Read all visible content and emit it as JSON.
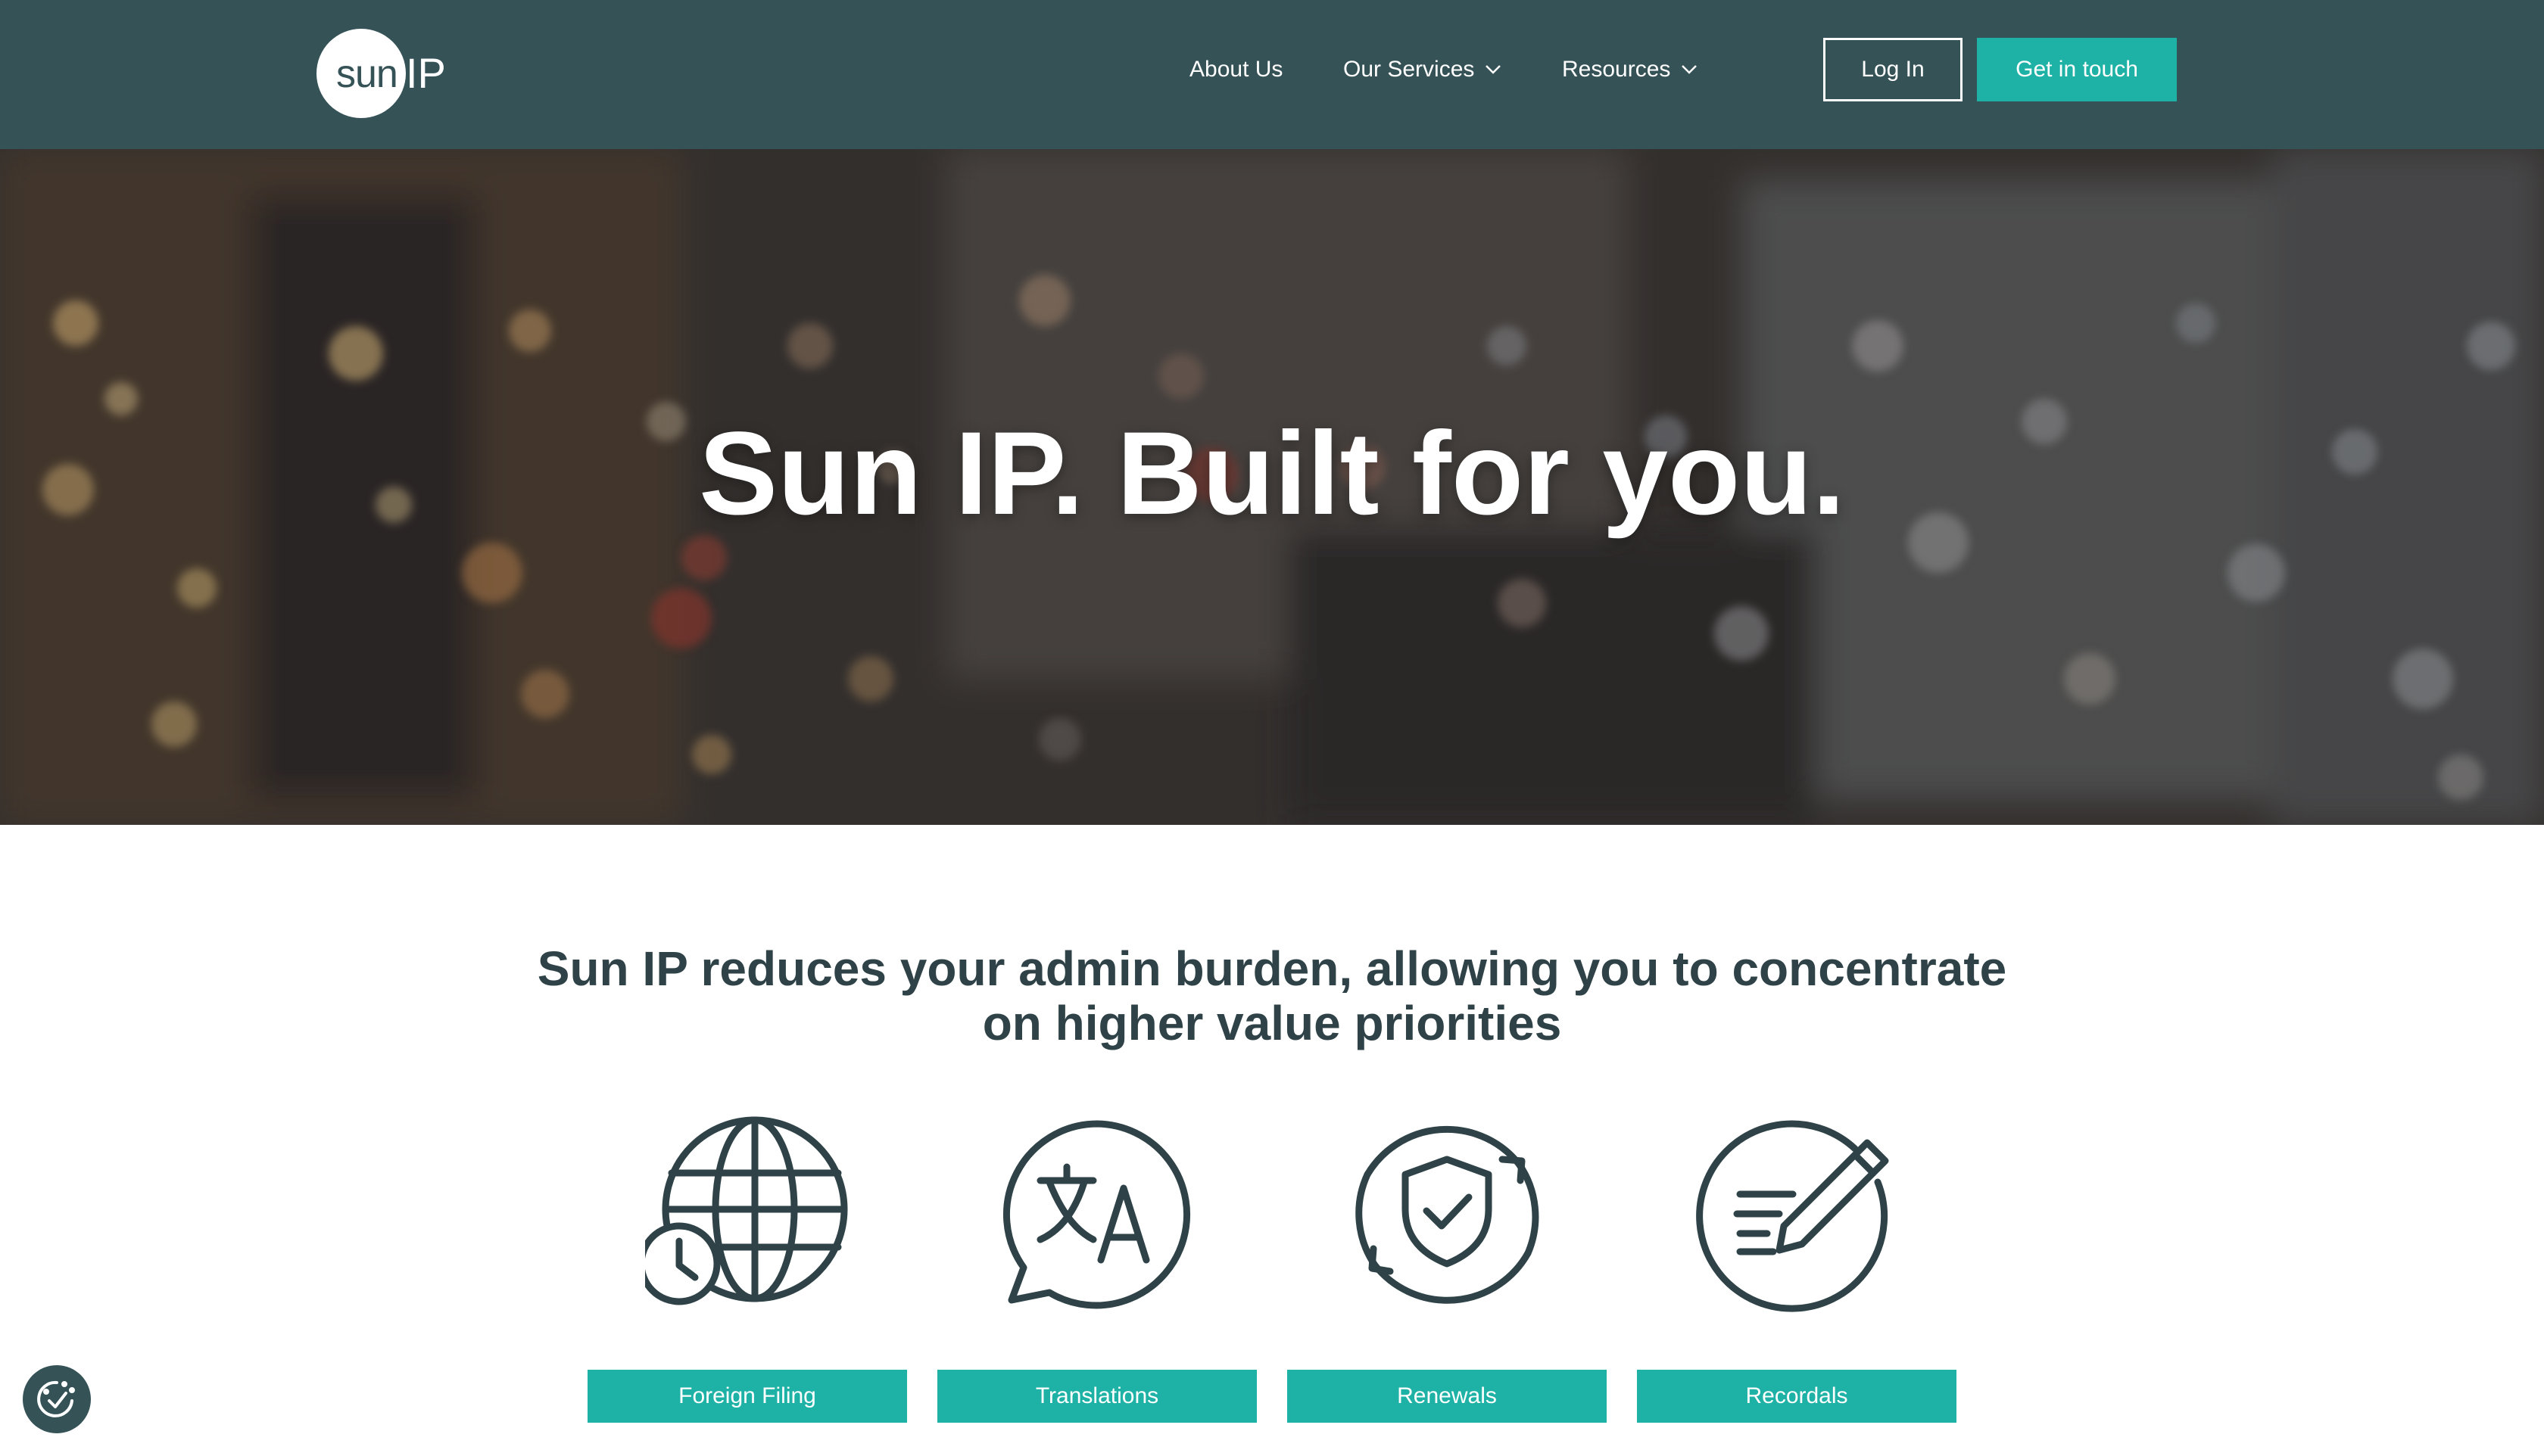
{
  "header": {
    "logo": {
      "part1": "sun",
      "part2": "IP"
    },
    "nav": [
      {
        "label": "About Us",
        "has_dropdown": false
      },
      {
        "label": "Our Services",
        "has_dropdown": true
      },
      {
        "label": "Resources",
        "has_dropdown": true
      }
    ],
    "login_label": "Log In",
    "contact_label": "Get in touch"
  },
  "hero": {
    "title": "Sun IP. Built for you."
  },
  "intro": {
    "line1": "Sun IP reduces your admin burden, allowing you to concentrate",
    "line2": "on higher value priorities"
  },
  "services": [
    {
      "label": "Foreign Filing",
      "icon": "globe-clock-icon"
    },
    {
      "label": "Translations",
      "icon": "translate-bubble-icon"
    },
    {
      "label": "Renewals",
      "icon": "shield-refresh-icon"
    },
    {
      "label": "Recordals",
      "icon": "pencil-lines-icon"
    }
  ],
  "colors": {
    "header_bg": "#355257",
    "accent": "#1eb2a6",
    "text_dark": "#2e4247"
  }
}
